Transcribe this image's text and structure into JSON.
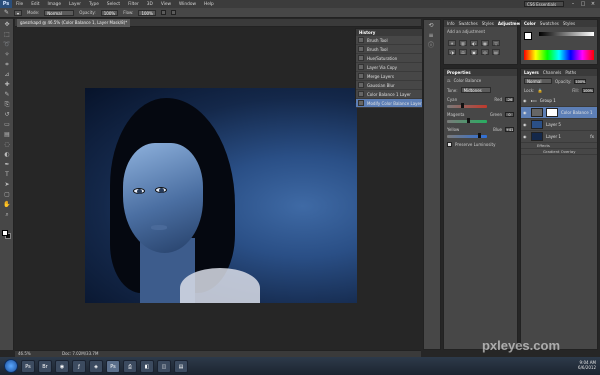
{
  "app": {
    "logo": "Ps",
    "workspace": "CS6 Essentials"
  },
  "menu": [
    "File",
    "Edit",
    "Image",
    "Layer",
    "Type",
    "Select",
    "Filter",
    "3D",
    "View",
    "Window",
    "Help"
  ],
  "options": {
    "mode_label": "Mode:",
    "mode_value": "Normal",
    "opacity_label": "Opacity:",
    "opacity_value": "100%",
    "flow_label": "Flow:",
    "flow_value": "100%"
  },
  "document": {
    "tab": "gaezrkapd @ 46.5% (Color Balance 1, Layer Mask/8)*",
    "zoom": "46.5%",
    "doc_info": "Doc: 7.02M/33.7M"
  },
  "history": {
    "title": "History",
    "items": [
      {
        "label": "Brush Tool",
        "selected": false
      },
      {
        "label": "Brush Tool",
        "selected": false
      },
      {
        "label": "Hue/Saturation",
        "selected": false
      },
      {
        "label": "Layer Via Copy",
        "selected": false
      },
      {
        "label": "Merge Layers",
        "selected": false
      },
      {
        "label": "Gaussian Blur",
        "selected": false
      },
      {
        "label": "Color Balance 1 Layer",
        "selected": false
      },
      {
        "label": "Modify Color Balance Layer",
        "selected": true
      }
    ]
  },
  "adjust": {
    "tabs": [
      "Info",
      "Swatches",
      "Styles",
      "Adjustments"
    ],
    "active": "Adjustments",
    "subtitle": "Add an adjustment",
    "icons": [
      "☀",
      "▥",
      "◐",
      "▦",
      "▽",
      "◑",
      "⚖",
      "▣",
      "◎",
      "▤"
    ]
  },
  "properties": {
    "tab": "Properties",
    "title": "Color Balance",
    "tone_label": "Tone:",
    "tone_value": "Midtones",
    "sliders": [
      {
        "left": "Cyan",
        "right": "Red",
        "value": "-26",
        "pos": 0.35,
        "color": "#c0392b"
      },
      {
        "left": "Magenta",
        "right": "Green",
        "value": "0",
        "pos": 0.5,
        "color": "#27ae60"
      },
      {
        "left": "Yellow",
        "right": "Blue",
        "value": "+41",
        "pos": 0.78,
        "color": "#2e6fd8"
      }
    ],
    "preserve": "Preserve Luminosity"
  },
  "color": {
    "tabs": [
      "Color",
      "Swatches",
      "Styles"
    ]
  },
  "layers": {
    "tabs": [
      "Layers",
      "Channels",
      "Paths"
    ],
    "blend": "Normal",
    "opacity_label": "Opacity:",
    "opacity_value": "100%",
    "fill_label": "Fill:",
    "fill_value": "100%",
    "lock_label": "Lock:",
    "rows": [
      {
        "name": "Group 1",
        "type": "group",
        "selected": false
      },
      {
        "name": "Color Balance 1",
        "type": "adjust",
        "selected": true
      },
      {
        "name": "Layer 5",
        "type": "image",
        "selected": false
      },
      {
        "name": "Layer 1",
        "type": "image",
        "selected": false
      }
    ],
    "effects": [
      "Effects",
      "Gradient Overlay"
    ]
  },
  "taskbar": {
    "time": "9:04 AM",
    "date": "6/6/2012",
    "buttons": [
      "Ps",
      "Br",
      "◉",
      "ƒ",
      "◈",
      "Ps",
      "⎙",
      "◧",
      "◫",
      "▤"
    ]
  },
  "watermark": "pxleyes.com"
}
